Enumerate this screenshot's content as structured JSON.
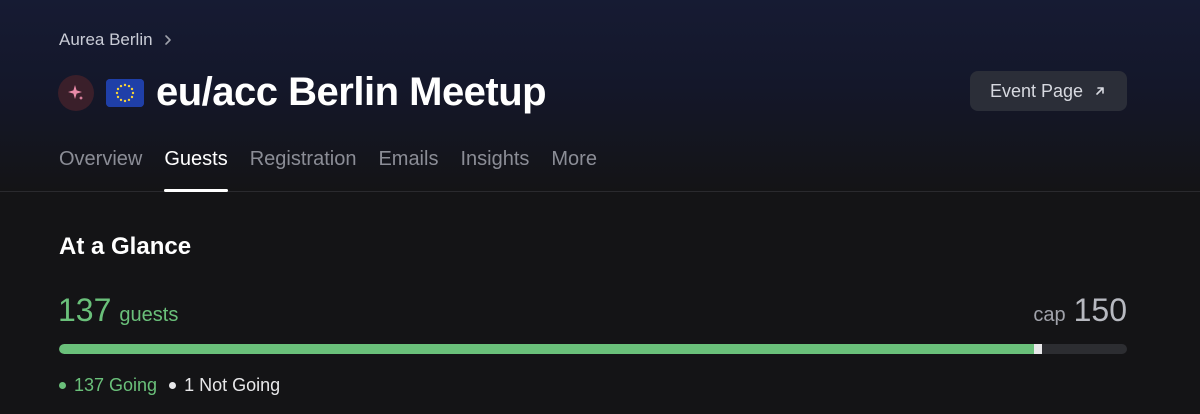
{
  "breadcrumb": {
    "calendar": "Aurea Berlin",
    "icon": "chevron-right-icon"
  },
  "event": {
    "avatar_icon": "sparkle-icon",
    "flag_icon": "eu-flag-icon",
    "title": "eu/acc Berlin Meetup",
    "event_page_label": "Event Page",
    "event_page_icon": "arrow-up-right-icon"
  },
  "tabs": [
    {
      "label": "Overview",
      "active": false
    },
    {
      "label": "Guests",
      "active": true
    },
    {
      "label": "Registration",
      "active": false
    },
    {
      "label": "Emails",
      "active": false
    },
    {
      "label": "Insights",
      "active": false
    },
    {
      "label": "More",
      "active": false
    }
  ],
  "glance": {
    "title": "At a Glance",
    "guests_count": "137",
    "guests_label": "guests",
    "cap_label": "cap",
    "cap_value": "150",
    "progress": {
      "going": 137,
      "not_going": 1,
      "capacity": 150
    },
    "legend": [
      {
        "label": "137 Going",
        "color": "#6ac07a"
      },
      {
        "label": "1 Not Going",
        "color": "#e8e8ea"
      }
    ]
  },
  "colors": {
    "accent_green": "#6ac07a",
    "button_bg": "#2b2e38",
    "background": "#141416"
  }
}
